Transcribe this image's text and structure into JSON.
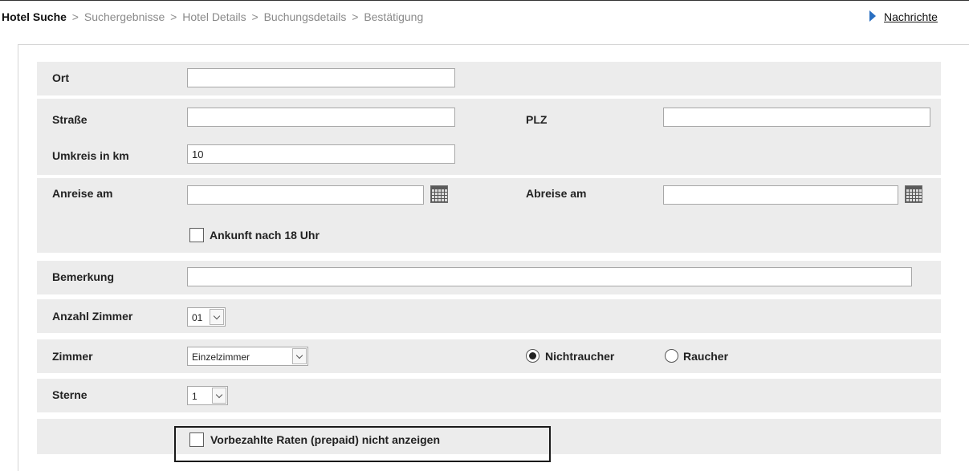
{
  "breadcrumb": {
    "active": "Hotel Suche",
    "separator": ">",
    "steps": [
      "Suchergebnisse",
      "Hotel Details",
      "Buchungsdetails",
      "Bestätigung"
    ]
  },
  "header": {
    "news_link": "Nachrichte"
  },
  "form": {
    "ort": {
      "label": "Ort",
      "value": ""
    },
    "strasse": {
      "label": "Straße",
      "value": ""
    },
    "plz": {
      "label": "PLZ",
      "value": ""
    },
    "umkreis": {
      "label": "Umkreis in km",
      "value": "10"
    },
    "anreise": {
      "label": "Anreise am",
      "value": ""
    },
    "abreise": {
      "label": "Abreise am",
      "value": ""
    },
    "late_arrival": {
      "label": "Ankunft nach 18 Uhr",
      "checked": false
    },
    "bemerkung": {
      "label": "Bemerkung",
      "value": ""
    },
    "anzahl_zimmer": {
      "label": "Anzahl Zimmer",
      "value": "01"
    },
    "zimmer": {
      "label": "Zimmer",
      "value": "Einzelzimmer"
    },
    "smoking": {
      "options": [
        {
          "label": "Nichtraucher",
          "selected": true
        },
        {
          "label": "Raucher",
          "selected": false
        }
      ]
    },
    "sterne": {
      "label": "Sterne",
      "value": "1"
    },
    "prepaid": {
      "label": "Vorbezahlte Raten (prepaid) nicht anzeigen",
      "checked": false
    }
  },
  "icons": {
    "calendar": "calendar-icon",
    "news_arrow": "triangle-right-icon",
    "dropdown": "chevron-down-icon"
  },
  "colors": {
    "row_background": "#ececec",
    "news_arrow": "#2a6fc1",
    "highlight_border": "#1a1a1a"
  }
}
